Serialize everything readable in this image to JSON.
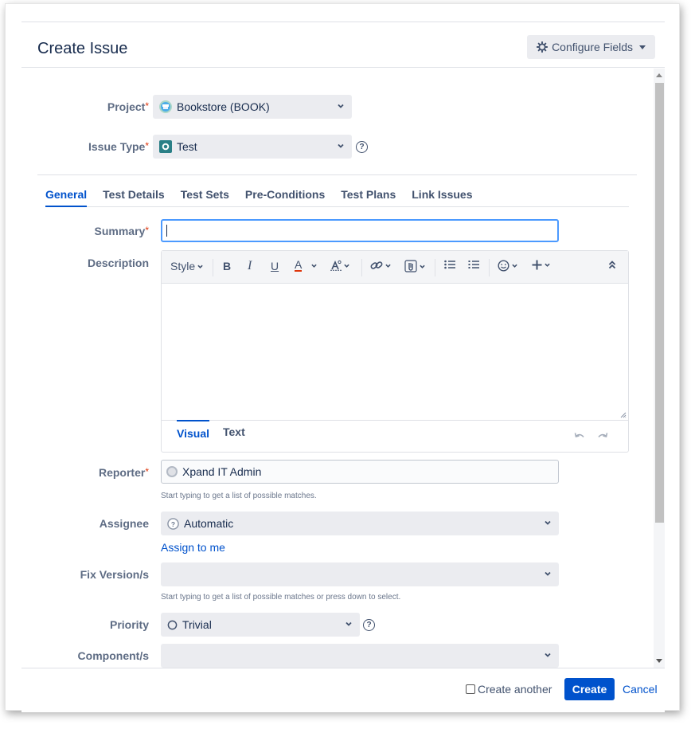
{
  "dialog": {
    "title": "Create Issue",
    "configure_label": "Configure Fields"
  },
  "fields": {
    "project": {
      "label": "Project",
      "required_mark": "*",
      "value": "Bookstore (BOOK)"
    },
    "issue_type": {
      "label": "Issue Type",
      "required_mark": "*",
      "value": "Test",
      "help": "?"
    },
    "summary": {
      "label": "Summary",
      "required_mark": "*",
      "value": ""
    },
    "description": {
      "label": "Description"
    },
    "reporter": {
      "label": "Reporter",
      "required_mark": "*",
      "value": "Xpand IT Admin",
      "hint": "Start typing to get a list of possible matches."
    },
    "assignee": {
      "label": "Assignee",
      "value": "Automatic",
      "assign_link": "Assign to me"
    },
    "fix_version": {
      "label": "Fix Version/s",
      "value": "",
      "hint": "Start typing to get a list of possible matches or press down to select."
    },
    "priority": {
      "label": "Priority",
      "value": "Trivial",
      "help": "?"
    },
    "components": {
      "label": "Component/s",
      "value": ""
    }
  },
  "tabs": [
    "General",
    "Test Details",
    "Test Sets",
    "Pre-Conditions",
    "Test Plans",
    "Link Issues"
  ],
  "editor": {
    "style_label": "Style",
    "bold": "B",
    "italic": "I",
    "underline": "U",
    "text_color": "A",
    "mode_tabs": [
      "Visual",
      "Text"
    ]
  },
  "footer": {
    "create_another_label": "Create another",
    "create_label": "Create",
    "cancel_label": "Cancel"
  },
  "colors": {
    "primary": "#0052cc",
    "required": "#de350b",
    "focus": "#4c9aff"
  }
}
